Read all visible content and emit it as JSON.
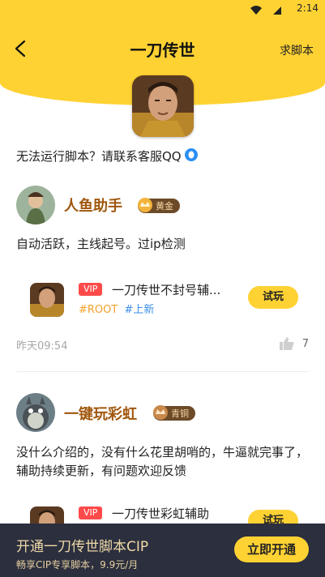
{
  "status": {
    "time": "2:14"
  },
  "header": {
    "title": "一刀传世",
    "request_label": "求脚本"
  },
  "notice": "无法运行脚本？请联系客服QQ",
  "posts": [
    {
      "username": "人鱼助手",
      "badge": "黄金",
      "text": "自动活跃，主线起号。过ip检测",
      "script": {
        "vip": "VIP",
        "name": "一刀传世不封号辅...",
        "tag1": "#ROOT",
        "tag2": "#上新",
        "try_label": "试玩"
      },
      "time": "昨天09:54",
      "likes": "7"
    },
    {
      "username": "一键玩彩虹",
      "badge": "青铜",
      "text": "没什么介绍的，没有什么花里胡哨的，牛逼就完事了，辅助持续更新，有问题欢迎反馈",
      "script": {
        "vip": "VIP",
        "name": "一刀传世彩虹辅助",
        "try_label": "试玩"
      }
    }
  ],
  "bottom": {
    "title": "开通一刀传世脚本CIP",
    "subtitle": "畅享CIP专享脚本，9.9元/月",
    "button": "立即开通"
  },
  "colors": {
    "accent": "#ffd233",
    "vip": "#ff4a4a",
    "username": "#a0570d",
    "bottom_bg": "#2b2f3e"
  }
}
